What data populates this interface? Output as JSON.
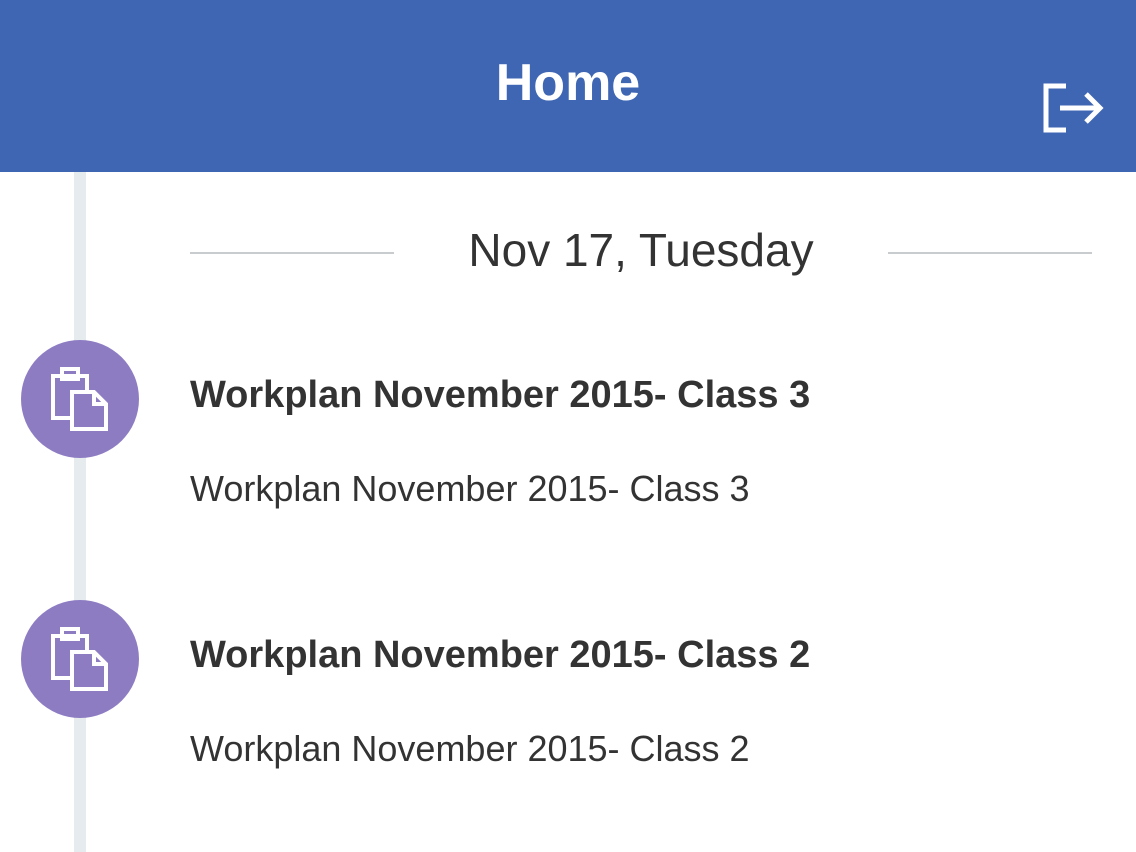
{
  "header": {
    "title": "Home",
    "logout_icon": "logout-icon",
    "background_color": "#3f66b3"
  },
  "timeline": {
    "date_label": "Nov 17, Tuesday",
    "items": [
      {
        "icon": "clipboard-icon",
        "title": "Workplan November 2015- Class 3",
        "subtitle": "Workplan November 2015- Class 3"
      },
      {
        "icon": "clipboard-icon",
        "title": "Workplan November 2015- Class 2",
        "subtitle": "Workplan November 2015- Class 2"
      }
    ],
    "icon_color": "#8e7cc3"
  }
}
